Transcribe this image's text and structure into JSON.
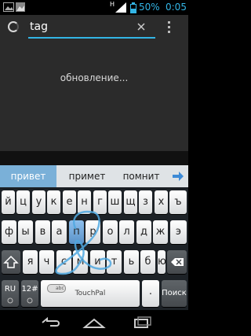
{
  "status_bar": {
    "battery_percent": "50%",
    "clock": "0:05",
    "network_type": "H",
    "icons": [
      "image-notification-icon",
      "network-h-icon",
      "signal-icon",
      "battery-icon"
    ]
  },
  "search": {
    "query": "tag",
    "clear_icon": "close-icon",
    "overflow_icon": "overflow-menu-icon"
  },
  "content": {
    "loading_text": "обновление..."
  },
  "keyboard": {
    "suggestions": [
      "привет",
      "примет",
      "помнит"
    ],
    "active_suggestion_index": 0,
    "rows": [
      [
        "й",
        "ц",
        "у",
        "к",
        "е",
        "н",
        "г",
        "ш",
        "щ",
        "з",
        "х",
        "ъ"
      ],
      [
        "ф",
        "ы",
        "в",
        "а",
        "п",
        "р",
        "о",
        "л",
        "д",
        "ж",
        "э"
      ],
      [
        "я",
        "ч",
        "с",
        "м",
        "и",
        "т",
        "ь",
        "б",
        "ю"
      ]
    ],
    "highlighted_key": "п",
    "bottom_row": {
      "lang": "RU",
      "symbols": "12#",
      "space_brand": "TouchPal",
      "space_toggle": "abc",
      "dot": ".",
      "search": "Поиск"
    },
    "accent_color": "#33b5e5"
  },
  "nav_bar": {
    "icons": [
      "back-icon",
      "home-icon",
      "recent-apps-icon"
    ]
  }
}
